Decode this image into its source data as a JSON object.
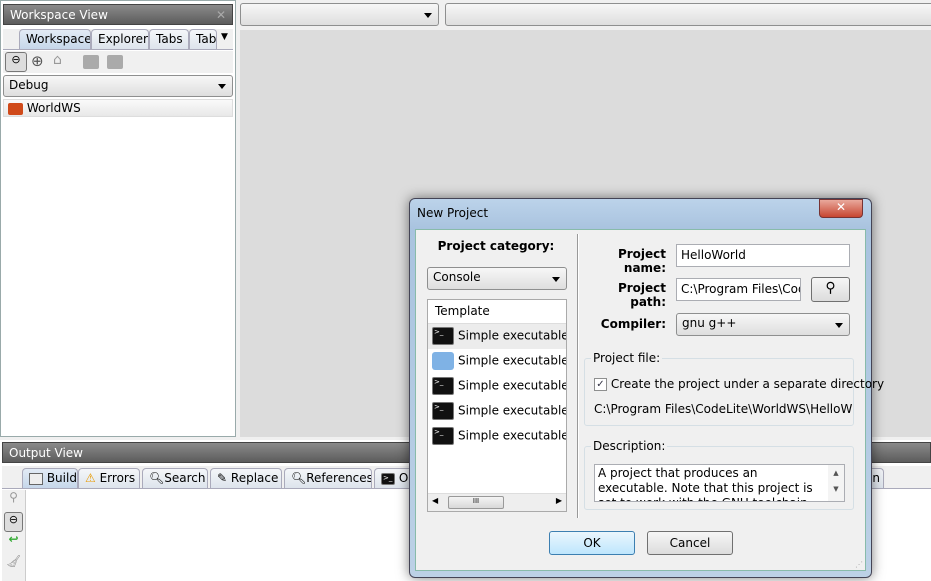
{
  "workspace_view": {
    "title": "Workspace View",
    "tabs": [
      "Workspace",
      "Explorer",
      "Tabs",
      "Tab"
    ],
    "config": "Debug",
    "tree": [
      {
        "label": "WorldWS",
        "icon": "workspace-folder-icon"
      }
    ]
  },
  "output_view": {
    "title": "Output View",
    "tabs": [
      {
        "label": "Build",
        "icon": "build-icon"
      },
      {
        "label": "Errors",
        "icon": "warning-icon"
      },
      {
        "label": "Search",
        "icon": "search-icon"
      },
      {
        "label": "Replace",
        "icon": "replace-icon"
      },
      {
        "label": "References",
        "icon": "search-icon"
      },
      {
        "label": "O",
        "icon": "terminal-icon"
      }
    ],
    "partial_tab": "on"
  },
  "dialog": {
    "title": "New Project",
    "category_label": "Project category:",
    "category": "Console",
    "template_header": "Template",
    "templates": [
      {
        "label": "Simple executable (g",
        "icon": "terminal-icon"
      },
      {
        "label": "Simple executable (C",
        "icon": "hammer-icon"
      },
      {
        "label": "Simple executable (w",
        "icon": "terminal-icon"
      },
      {
        "label": "Simple executable (g",
        "icon": "terminal-icon"
      },
      {
        "label": "Simple executable (M",
        "icon": "terminal-icon"
      }
    ],
    "name_label": "Project name:",
    "name": "HelloWorld",
    "path_label": "Project path:",
    "path": "C:\\Program Files\\CodeLite\\WorldWS",
    "compiler_label": "Compiler:",
    "compiler": "gnu g++",
    "project_file_label": "Project file:",
    "separate_dir_label": "Create the project under a separate directory",
    "separate_dir_checked": true,
    "full_path": "C:\\Program Files\\CodeLite\\WorldWS\\HelloWorld\\HelloWorld.project",
    "description_label": "Description:",
    "description": "A project that produces an executable. Note that this project is set to work with the GNU toolchain (gdb and g++)",
    "ok": "OK",
    "cancel": "Cancel"
  }
}
